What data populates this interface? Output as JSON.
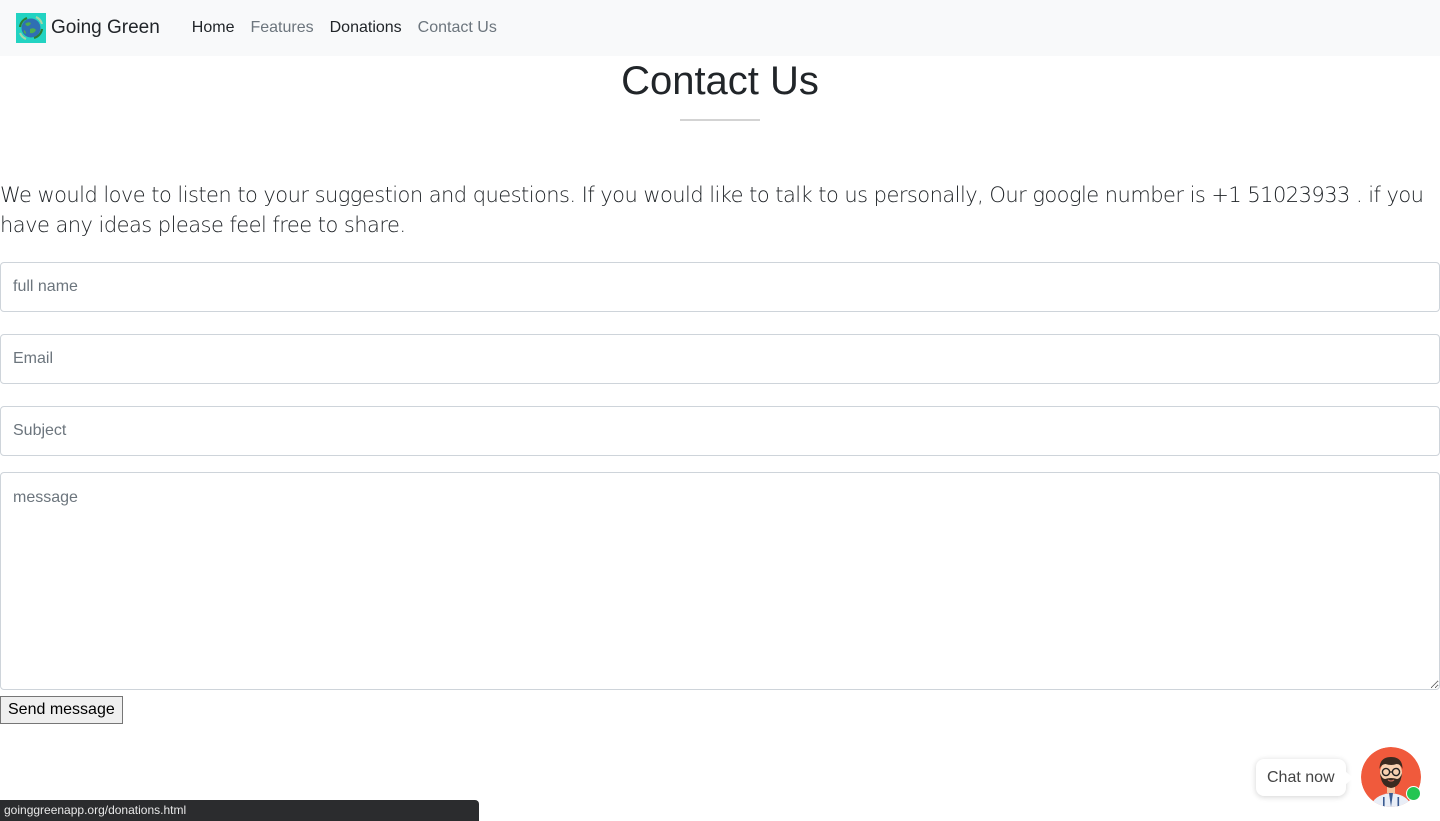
{
  "navbar": {
    "brand": "Going Green",
    "links": [
      {
        "label": "Home",
        "state": "active"
      },
      {
        "label": "Features",
        "state": "muted"
      },
      {
        "label": "Donations",
        "state": "hover"
      },
      {
        "label": "Contact Us",
        "state": "muted"
      }
    ]
  },
  "contact": {
    "title": "Contact Us",
    "intro": "We would love to listen to your suggestion and questions. If you would like to talk to us personally, Our google number is +1 51023933 . if you have any ideas please feel free to share.",
    "placeholders": {
      "name": "full name",
      "email": "Email",
      "subject": "Subject",
      "message": "message"
    },
    "send_label": "Send message"
  },
  "status_bar": {
    "url": "goinggreenapp.org/donations.html"
  },
  "chat": {
    "label": "Chat now",
    "online_color": "#23c552"
  },
  "icons": {
    "brand": "earth-recycle-logo-icon",
    "avatar": "bearded-man-avatar-icon",
    "status": "online-status-icon"
  },
  "colors": {
    "navbar_bg": "#f8f9fa",
    "text_dark": "#212529",
    "text_muted": "#6c757d",
    "avatar_bg": "#f05a3c",
    "input_border": "#ced4da"
  }
}
